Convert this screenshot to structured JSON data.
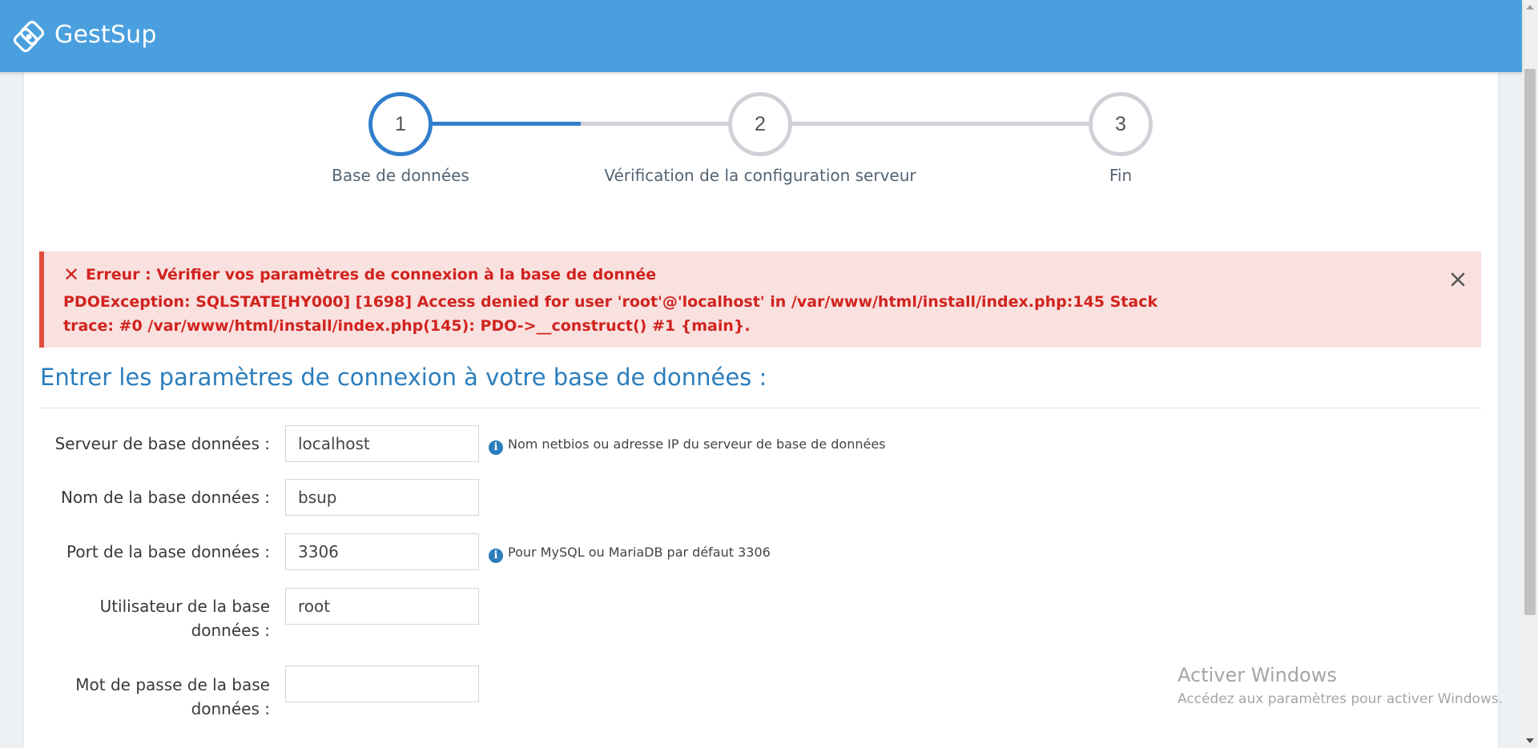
{
  "app": {
    "title": "GestSup"
  },
  "steps": [
    {
      "number": "1",
      "label": "Base de données",
      "active": true
    },
    {
      "number": "2",
      "label": "Vérification de la configuration serveur",
      "active": false
    },
    {
      "number": "3",
      "label": "Fin",
      "active": false
    }
  ],
  "alert": {
    "icon": "x-icon",
    "title": "Erreur : Vérifier vos paramètres de connexion à la base de donnée",
    "message": "PDOException: SQLSTATE[HY000] [1698] Access denied for user 'root'@'localhost' in /var/www/html/install/index.php:145 Stack trace: #0 /var/www/html/install/index.php(145): PDO->__construct() #1 {main}.",
    "close_icon": "close-icon"
  },
  "section_title": "Entrer les paramètres de connexion à votre base de données :",
  "fields": [
    {
      "label": "Serveur de base données :",
      "value": "localhost",
      "hint": "Nom netbios ou adresse IP du serveur de base de données"
    },
    {
      "label": "Nom de la base données :",
      "value": "bsup",
      "hint": ""
    },
    {
      "label": "Port de la base données :",
      "value": "3306",
      "hint": "Pour MySQL ou MariaDB par défaut 3306"
    },
    {
      "label": "Utilisateur de la base données :",
      "value": "root",
      "hint": ""
    },
    {
      "label": "Mot de passe de la base données :",
      "value": "",
      "hint": ""
    }
  ],
  "info_icon": "i",
  "watermark": {
    "title": "Activer Windows",
    "subtitle": "Accédez aux paramètres pour activer Windows."
  },
  "colors": {
    "header": "#4a9fdf",
    "accent": "#307ecc",
    "error_text": "#d1231f",
    "error_bg": "#f9e1df"
  }
}
